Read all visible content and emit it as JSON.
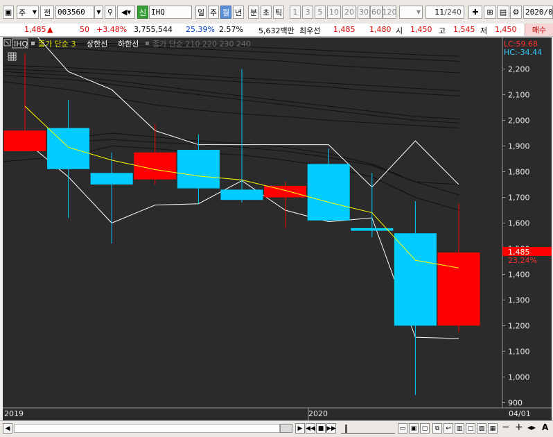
{
  "toolbar": {
    "market": "주",
    "prev_label": "전",
    "stock_code": "003560",
    "indicator_badge": "신",
    "indicator_name": "IHQ",
    "periods": [
      "일",
      "주",
      "월",
      "년",
      "분",
      "초",
      "틱"
    ],
    "selected_period": "월",
    "intervals": [
      "1",
      "3",
      "5",
      "10",
      "20",
      "30",
      "60",
      "120"
    ],
    "page_count": "11",
    "page_total": "/240",
    "date": "2020/0"
  },
  "quote": {
    "price": "1,485",
    "change_arrow": "▲",
    "change": "50",
    "change_pct": "+3.48%",
    "volume": "3,755,544",
    "turnover_ratio": "25.39%",
    "ratio2": "2.57%",
    "amount": "5,632백만",
    "best_label": "최우선",
    "ask": "1,485",
    "bid": "1,480",
    "open_label": "시",
    "open": "1,450",
    "high_label": "고",
    "high": "1,545",
    "low_label": "저",
    "low": "1,450",
    "buy_button": "매수"
  },
  "legend": {
    "stock": "IHQ",
    "ma_label": "종가 단순 3",
    "upper_label": "상한선",
    "lower_label": "하한선",
    "ma_long_label": "종가 단순 210 220 230 240"
  },
  "stats": {
    "lc": "LC:59.68",
    "hc": "HC:-34.44"
  },
  "price_tag": {
    "value": "1,485",
    "pct": "23.24%"
  },
  "x_labels": {
    "start": "2019",
    "mid": "2020",
    "end": "04/01"
  },
  "colors": {
    "background": "#2b2b2b",
    "up": "#ff0000",
    "down": "#00ccff",
    "ma": "#ffff00",
    "band": "#ffffff"
  },
  "chart_data": {
    "type": "candlestick",
    "ylim": [
      880,
      2300
    ],
    "yticks": [
      900,
      1000,
      1100,
      1200,
      1300,
      1400,
      1500,
      1600,
      1700,
      1800,
      1900,
      2000,
      2100,
      2200
    ],
    "candles": [
      {
        "o": 1880,
        "c": 1960,
        "h": 2260,
        "l": 1880
      },
      {
        "o": 1970,
        "c": 1810,
        "h": 2080,
        "l": 1620
      },
      {
        "o": 1795,
        "c": 1750,
        "h": 1875,
        "l": 1520
      },
      {
        "o": 1770,
        "c": 1875,
        "h": 1985,
        "l": 1750
      },
      {
        "o": 1885,
        "c": 1735,
        "h": 1945,
        "l": 1675
      },
      {
        "o": 1730,
        "c": 1690,
        "h": 2200,
        "l": 1680
      },
      {
        "o": 1700,
        "c": 1745,
        "h": 1760,
        "l": 1580
      },
      {
        "o": 1830,
        "c": 1610,
        "h": 1890,
        "l": 1605
      },
      {
        "o": 1580,
        "c": 1570,
        "h": 1795,
        "l": 1545
      },
      {
        "o": 1560,
        "c": 1200,
        "h": 1685,
        "l": 930
      },
      {
        "o": 1200,
        "c": 1485,
        "h": 1675,
        "l": 1175
      }
    ],
    "ma3": [
      2055,
      1895,
      1845,
      1808,
      1783,
      1768,
      1727,
      1681,
      1640,
      1455,
      1425
    ],
    "upper_band": [
      2380,
      2190,
      2120,
      1960,
      1905,
      1905,
      1905,
      1905,
      1740,
      1920,
      1750
    ],
    "lower_band": [
      1920,
      1780,
      1600,
      1670,
      1675,
      1765,
      1650,
      1605,
      1620,
      1155,
      1150
    ],
    "ma_long": [
      [
        2200,
        2190,
        2180,
        2170,
        2160,
        2150,
        2140,
        2130,
        2115,
        2105,
        2095
      ],
      [
        2215,
        2205,
        2195,
        2185,
        2175,
        2165,
        2155,
        2145,
        2135,
        2125,
        2115
      ],
      [
        2175,
        2160,
        2140,
        2120,
        2100,
        2080,
        2060,
        2040,
        2020,
        2000,
        1990
      ],
      [
        2190,
        2175,
        2155,
        2135,
        2115,
        2095,
        2075,
        2055,
        2035,
        2015,
        2005
      ],
      [
        2150,
        2120,
        2090,
        2060,
        2040,
        2025,
        2015,
        2000,
        1990,
        1980,
        1970
      ],
      [
        2290,
        2280,
        2270,
        2260,
        2250,
        2240,
        2230,
        2215,
        2205,
        2195,
        2185
      ],
      [
        2300,
        2295,
        2290,
        2285,
        2278,
        2270,
        2262,
        2252,
        2245,
        2238,
        2230
      ],
      [
        2300,
        2300,
        2300,
        2297,
        2292,
        2287,
        2280,
        2272,
        2264,
        2256,
        2250
      ],
      [
        1900,
        1930,
        1950,
        1935,
        1920,
        1910,
        1895,
        1870,
        1830,
        1760,
        1710
      ],
      [
        1900,
        1915,
        1925,
        1915,
        1905,
        1895,
        1880,
        1855,
        1825,
        1760,
        1750
      ],
      [
        1840,
        1860,
        1900,
        1890,
        1875,
        1865,
        1845,
        1820,
        1780,
        1700,
        1650
      ]
    ]
  }
}
